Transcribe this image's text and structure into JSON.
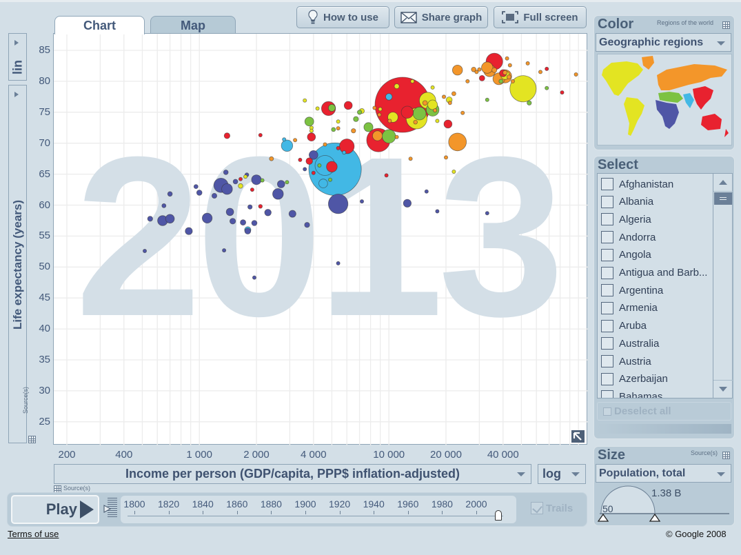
{
  "tabs": [
    {
      "label": "Chart",
      "active": true
    },
    {
      "label": "Map",
      "active": false
    }
  ],
  "toolbar": {
    "how_to_use": "How to use",
    "share_graph": "Share graph",
    "full_screen": "Full screen"
  },
  "yaxis": {
    "scale_label": "lin",
    "title": "Life expectancy (years)",
    "source_label": "Source(s)"
  },
  "xaxis": {
    "indicator": "Income per person (GDP/capita, PPP$ inflation-adjusted)",
    "scale": "log",
    "source_label": "Source(s)"
  },
  "play": {
    "label": "Play",
    "years": [
      "1800",
      "1820",
      "1840",
      "1860",
      "1880",
      "1900",
      "1920",
      "1940",
      "1960",
      "1980",
      "2000"
    ],
    "current_year": "2013",
    "trails_label": "Trails",
    "trails_checked": true
  },
  "footer": {
    "terms": "Terms of use",
    "copyright": "© Google 2008"
  },
  "color_panel": {
    "title": "Color",
    "subtitle": "Regions of the world",
    "selected": "Geographic regions",
    "region_colors": {
      "america": "#e3e422",
      "europe_central_asia": "#f3962a",
      "east_asia_pacific": "#e8222f",
      "south_asia": "#42b8e5",
      "middle_east_north_africa": "#7cc242",
      "sub_saharan_africa": "#4f56a6"
    }
  },
  "select_panel": {
    "title": "Select",
    "countries": [
      "Afghanistan",
      "Albania",
      "Algeria",
      "Andorra",
      "Angola",
      "Antigua and Barb...",
      "Argentina",
      "Armenia",
      "Aruba",
      "Australia",
      "Austria",
      "Azerbaijan",
      "Bahamas"
    ],
    "deselect_label": "Deselect all"
  },
  "size_panel": {
    "title": "Size",
    "source_label": "Source(s)",
    "selected": "Population, total",
    "max_label": "1.38 B",
    "min_label": "50"
  },
  "chart_data": {
    "type": "scatter",
    "title": "2013",
    "xlabel": "Income per person (GDP/capita, PPP$ inflation-adjusted)",
    "ylabel": "Life expectancy (years)",
    "xscale": "log",
    "xlim": [
      150,
      110000
    ],
    "ylim": [
      21,
      87
    ],
    "xticks": [
      200,
      400,
      1000,
      2000,
      4000,
      10000,
      20000,
      40000
    ],
    "xtick_labels": [
      "200",
      "400",
      "1 000",
      "2 000",
      "4 000",
      "10 000",
      "20 000",
      "40 000"
    ],
    "yticks": [
      25,
      30,
      35,
      40,
      45,
      50,
      55,
      60,
      65,
      70,
      75,
      80,
      85
    ],
    "grid": true,
    "size_indicator": "Population, total (millions)",
    "points": [
      {
        "region": "east_asia_pacific",
        "x": 11800,
        "y": 76.2,
        "size": 1380
      },
      {
        "region": "south_asia",
        "x": 5200,
        "y": 65.8,
        "size": 1250
      },
      {
        "region": "america",
        "x": 51000,
        "y": 78.8,
        "size": 316
      },
      {
        "region": "east_asia_pacific",
        "x": 8800,
        "y": 70.5,
        "size": 250
      },
      {
        "region": "south_asia",
        "x": 4600,
        "y": 66.4,
        "size": 182
      },
      {
        "region": "south_asia",
        "x": 2900,
        "y": 69.6,
        "size": 60
      },
      {
        "region": "america",
        "x": 14000,
        "y": 74.0,
        "size": 200
      },
      {
        "region": "sub_saharan_africa",
        "x": 5400,
        "y": 60.2,
        "size": 173
      },
      {
        "region": "south_asia",
        "x": 4500,
        "y": 63.5,
        "size": 35
      },
      {
        "region": "europe_central_asia",
        "x": 23000,
        "y": 70.2,
        "size": 143
      },
      {
        "region": "east_asia_pacific",
        "x": 36000,
        "y": 83.2,
        "size": 127
      },
      {
        "region": "america",
        "x": 16000,
        "y": 76.9,
        "size": 122
      },
      {
        "region": "east_asia_pacific",
        "x": 6000,
        "y": 69.5,
        "size": 98
      },
      {
        "region": "sub_saharan_africa",
        "x": 1300,
        "y": 63.2,
        "size": 94
      },
      {
        "region": "middle_east_north_africa",
        "x": 10000,
        "y": 71.1,
        "size": 82
      },
      {
        "region": "europe_central_asia",
        "x": 41000,
        "y": 80.8,
        "size": 80
      },
      {
        "region": "middle_east_north_africa",
        "x": 14500,
        "y": 74.8,
        "size": 77
      },
      {
        "region": "middle_east_north_africa",
        "x": 17000,
        "y": 75.4,
        "size": 75
      },
      {
        "region": "east_asia_pacific",
        "x": 4800,
        "y": 75.6,
        "size": 90
      },
      {
        "region": "europe_central_asia",
        "x": 34000,
        "y": 81.7,
        "size": 64
      },
      {
        "region": "europe_central_asia",
        "x": 38000,
        "y": 80.4,
        "size": 64
      },
      {
        "region": "europe_central_asia",
        "x": 33000,
        "y": 82.2,
        "size": 60
      },
      {
        "region": "east_asia_pacific",
        "x": 12500,
        "y": 75.0,
        "size": 67
      },
      {
        "region": "sub_saharan_africa",
        "x": 1400,
        "y": 62.6,
        "size": 53
      },
      {
        "region": "sub_saharan_africa",
        "x": 2000,
        "y": 64.1,
        "size": 44
      },
      {
        "region": "east_asia_pacific",
        "x": 5000,
        "y": 66.2,
        "size": 53
      },
      {
        "region": "middle_east_north_africa",
        "x": 3800,
        "y": 73.5,
        "size": 36
      },
      {
        "region": "sub_saharan_africa",
        "x": 1100,
        "y": 57.9,
        "size": 45
      },
      {
        "region": "sub_saharan_africa",
        "x": 2600,
        "y": 61.8,
        "size": 52
      },
      {
        "region": "europe_central_asia",
        "x": 23000,
        "y": 81.8,
        "size": 46
      },
      {
        "region": "middle_east_north_africa",
        "x": 7800,
        "y": 72.6,
        "size": 38
      },
      {
        "region": "america",
        "x": 10500,
        "y": 74.2,
        "size": 47
      },
      {
        "region": "europe_central_asia",
        "x": 8700,
        "y": 71.2,
        "size": 45
      },
      {
        "region": "sub_saharan_africa",
        "x": 640,
        "y": 57.5,
        "size": 46
      },
      {
        "region": "sub_saharan_africa",
        "x": 700,
        "y": 57.8,
        "size": 35
      },
      {
        "region": "america",
        "x": 17000,
        "y": 76.2,
        "size": 42
      },
      {
        "region": "east_asia_pacific",
        "x": 3900,
        "y": 71.0,
        "size": 30
      },
      {
        "region": "sub_saharan_africa",
        "x": 2700,
        "y": 63.4,
        "size": 25
      },
      {
        "region": "sub_saharan_africa",
        "x": 1450,
        "y": 58.9,
        "size": 25
      },
      {
        "region": "sub_saharan_africa",
        "x": 880,
        "y": 55.8,
        "size": 23
      },
      {
        "region": "sub_saharan_africa",
        "x": 3100,
        "y": 58.6,
        "size": 22
      },
      {
        "region": "america",
        "x": 41000,
        "y": 81.0,
        "size": 35
      },
      {
        "region": "middle_east_north_africa",
        "x": 5000,
        "y": 75.7,
        "size": 22
      },
      {
        "region": "sub_saharan_africa",
        "x": 2300,
        "y": 58.8,
        "size": 20
      },
      {
        "region": "sub_saharan_africa",
        "x": 1800,
        "y": 55.8,
        "size": 16
      },
      {
        "region": "south_asia",
        "x": 1800,
        "y": 56.0,
        "size": 18
      },
      {
        "region": "sub_saharan_africa",
        "x": 1500,
        "y": 57.4,
        "size": 15
      },
      {
        "region": "sub_saharan_africa",
        "x": 1700,
        "y": 57.2,
        "size": 14
      },
      {
        "region": "sub_saharan_africa",
        "x": 1950,
        "y": 57.1,
        "size": 13
      },
      {
        "region": "sub_saharan_africa",
        "x": 3700,
        "y": 56.8,
        "size": 12
      },
      {
        "region": "sub_saharan_africa",
        "x": 1000,
        "y": 62.0,
        "size": 13
      },
      {
        "region": "sub_saharan_africa",
        "x": 550,
        "y": 57.8,
        "size": 12
      },
      {
        "region": "sub_saharan_africa",
        "x": 1200,
        "y": 61.5,
        "size": 11
      },
      {
        "region": "sub_saharan_africa",
        "x": 1550,
        "y": 63.8,
        "size": 10
      },
      {
        "region": "sub_saharan_africa",
        "x": 1850,
        "y": 59.7,
        "size": 9
      },
      {
        "region": "sub_saharan_africa",
        "x": 1380,
        "y": 65.3,
        "size": 10
      },
      {
        "region": "sub_saharan_africa",
        "x": 960,
        "y": 63.0,
        "size": 8
      },
      {
        "region": "sub_saharan_africa",
        "x": 700,
        "y": 61.8,
        "size": 10
      },
      {
        "region": "sub_saharan_africa",
        "x": 650,
        "y": 59.9,
        "size": 8
      },
      {
        "region": "sub_saharan_africa",
        "x": 515,
        "y": 52.6,
        "size": 6
      },
      {
        "region": "sub_saharan_africa",
        "x": 1350,
        "y": 52.7,
        "size": 4
      },
      {
        "region": "sub_saharan_africa",
        "x": 1950,
        "y": 48.3,
        "size": 5
      },
      {
        "region": "sub_saharan_africa",
        "x": 5400,
        "y": 50.6,
        "size": 2
      },
      {
        "region": "sub_saharan_africa",
        "x": 7200,
        "y": 60.6,
        "size": 4
      },
      {
        "region": "sub_saharan_africa",
        "x": 12500,
        "y": 60.3,
        "size": 28
      },
      {
        "region": "sub_saharan_africa",
        "x": 18000,
        "y": 59.0,
        "size": 2
      },
      {
        "region": "sub_saharan_africa",
        "x": 33000,
        "y": 58.7,
        "size": 2
      },
      {
        "region": "sub_saharan_africa",
        "x": 15800,
        "y": 62.2,
        "size": 3
      },
      {
        "region": "sub_saharan_africa",
        "x": 3600,
        "y": 65.8,
        "size": 3
      },
      {
        "region": "sub_saharan_africa",
        "x": 4000,
        "y": 68.1,
        "size": 35
      },
      {
        "region": "sub_saharan_africa",
        "x": 1780,
        "y": 64.9,
        "size": 7
      },
      {
        "region": "america",
        "x": 1650,
        "y": 63.1,
        "size": 10
      },
      {
        "region": "east_asia_pacific",
        "x": 1400,
        "y": 71.2,
        "size": 15
      },
      {
        "region": "east_asia_pacific",
        "x": 2100,
        "y": 71.3,
        "size": 3
      },
      {
        "region": "east_asia_pacific",
        "x": 2100,
        "y": 59.8,
        "size": 7
      },
      {
        "region": "east_asia_pacific",
        "x": 3400,
        "y": 67.3,
        "size": 3
      },
      {
        "region": "east_asia_pacific",
        "x": 3800,
        "y": 67.1,
        "size": 20
      },
      {
        "region": "east_asia_pacific",
        "x": 4000,
        "y": 65.2,
        "size": 4
      },
      {
        "region": "east_asia_pacific",
        "x": 5400,
        "y": 69.2,
        "size": 2
      },
      {
        "region": "east_asia_pacific",
        "x": 1650,
        "y": 64.2,
        "size": 3
      },
      {
        "region": "east_asia_pacific",
        "x": 1900,
        "y": 62.5,
        "size": 2
      },
      {
        "region": "east_asia_pacific",
        "x": 9700,
        "y": 64.8,
        "size": 2
      },
      {
        "region": "east_asia_pacific",
        "x": 6100,
        "y": 76.1,
        "size": 30
      },
      {
        "region": "east_asia_pacific",
        "x": 20500,
        "y": 73.1,
        "size": 30
      },
      {
        "region": "east_asia_pacific",
        "x": 40000,
        "y": 81.3,
        "size": 23
      },
      {
        "region": "east_asia_pacific",
        "x": 68000,
        "y": 82.0,
        "size": 5
      },
      {
        "region": "east_asia_pacific",
        "x": 82000,
        "y": 78.2,
        "size": 2
      },
      {
        "region": "east_asia_pacific",
        "x": 31000,
        "y": 80.5,
        "size": 14
      },
      {
        "region": "south_asia",
        "x": 2800,
        "y": 70.6,
        "size": 5
      },
      {
        "region": "south_asia",
        "x": 10000,
        "y": 77.5,
        "size": 20
      },
      {
        "region": "south_asia",
        "x": 5800,
        "y": 68.5,
        "size": 2
      },
      {
        "region": "middle_east_north_africa",
        "x": 2900,
        "y": 63.7,
        "size": 4
      },
      {
        "region": "middle_east_north_africa",
        "x": 4900,
        "y": 64.1,
        "size": 3
      },
      {
        "region": "middle_east_north_africa",
        "x": 4300,
        "y": 66.4,
        "size": 3
      },
      {
        "region": "middle_east_north_africa",
        "x": 2150,
        "y": 64.0,
        "size": 2
      },
      {
        "region": "middle_east_north_africa",
        "x": 6700,
        "y": 73.9,
        "size": 12
      },
      {
        "region": "middle_east_north_africa",
        "x": 7000,
        "y": 75.0,
        "size": 9
      },
      {
        "region": "middle_east_north_africa",
        "x": 39000,
        "y": 80.0,
        "size": 8
      },
      {
        "region": "middle_east_north_africa",
        "x": 55000,
        "y": 76.5,
        "size": 9
      },
      {
        "region": "middle_east_north_africa",
        "x": 68000,
        "y": 78.9,
        "size": 2
      },
      {
        "region": "middle_east_north_africa",
        "x": 33000,
        "y": 77.0,
        "size": 2
      },
      {
        "region": "middle_east_north_africa",
        "x": 5100,
        "y": 72.2,
        "size": 8
      },
      {
        "region": "america",
        "x": 3900,
        "y": 72.5,
        "size": 4
      },
      {
        "region": "america",
        "x": 3600,
        "y": 76.9,
        "size": 4
      },
      {
        "region": "america",
        "x": 4200,
        "y": 75.6,
        "size": 2
      },
      {
        "region": "america",
        "x": 5400,
        "y": 73.5,
        "size": 6
      },
      {
        "region": "america",
        "x": 7200,
        "y": 75.2,
        "size": 11
      },
      {
        "region": "america",
        "x": 9000,
        "y": 75.5,
        "size": 5
      },
      {
        "region": "america",
        "x": 13300,
        "y": 80.0,
        "size": 4
      },
      {
        "region": "america",
        "x": 18000,
        "y": 73.6,
        "size": 3
      },
      {
        "region": "america",
        "x": 20800,
        "y": 77.0,
        "size": 16
      },
      {
        "region": "america",
        "x": 22000,
        "y": 65.4,
        "size": 2
      },
      {
        "region": "america",
        "x": 17000,
        "y": 79.0,
        "size": 4
      },
      {
        "region": "america",
        "x": 11000,
        "y": 79.2,
        "size": 11
      },
      {
        "region": "america",
        "x": 1750,
        "y": 64.6,
        "size": 2
      },
      {
        "region": "america",
        "x": 3900,
        "y": 72.0,
        "size": 3
      },
      {
        "region": "europe_central_asia",
        "x": 4600,
        "y": 69.8,
        "size": 3
      },
      {
        "region": "europe_central_asia",
        "x": 5400,
        "y": 72.4,
        "size": 5
      },
      {
        "region": "europe_central_asia",
        "x": 6500,
        "y": 72.0,
        "size": 9
      },
      {
        "region": "europe_central_asia",
        "x": 8900,
        "y": 74.6,
        "size": 4
      },
      {
        "region": "europe_central_asia",
        "x": 10100,
        "y": 73.6,
        "size": 3
      },
      {
        "region": "europe_central_asia",
        "x": 13800,
        "y": 73.4,
        "size": 7
      },
      {
        "region": "europe_central_asia",
        "x": 15500,
        "y": 76.5,
        "size": 10
      },
      {
        "region": "europe_central_asia",
        "x": 17500,
        "y": 75.3,
        "size": 4
      },
      {
        "region": "europe_central_asia",
        "x": 19500,
        "y": 77.5,
        "size": 5
      },
      {
        "region": "europe_central_asia",
        "x": 21000,
        "y": 76.5,
        "size": 6
      },
      {
        "region": "europe_central_asia",
        "x": 22000,
        "y": 78.0,
        "size": 8
      },
      {
        "region": "europe_central_asia",
        "x": 24500,
        "y": 74.9,
        "size": 4
      },
      {
        "region": "europe_central_asia",
        "x": 26000,
        "y": 80.0,
        "size": 5
      },
      {
        "region": "europe_central_asia",
        "x": 28000,
        "y": 81.9,
        "size": 10
      },
      {
        "region": "europe_central_asia",
        "x": 29000,
        "y": 81.5,
        "size": 2
      },
      {
        "region": "europe_central_asia",
        "x": 30000,
        "y": 81.9,
        "size": 4
      },
      {
        "region": "europe_central_asia",
        "x": 36000,
        "y": 81.8,
        "size": 11
      },
      {
        "region": "europe_central_asia",
        "x": 41000,
        "y": 81.4,
        "size": 9
      },
      {
        "region": "europe_central_asia",
        "x": 43000,
        "y": 80.7,
        "size": 8
      },
      {
        "region": "europe_central_asia",
        "x": 45000,
        "y": 80.0,
        "size": 5
      },
      {
        "region": "europe_central_asia",
        "x": 43500,
        "y": 82.6,
        "size": 2
      },
      {
        "region": "europe_central_asia",
        "x": 54000,
        "y": 82.9,
        "size": 5
      },
      {
        "region": "europe_central_asia",
        "x": 63000,
        "y": 81.5,
        "size": 5
      },
      {
        "region": "europe_central_asia",
        "x": 97000,
        "y": 81.1,
        "size": 1
      },
      {
        "region": "europe_central_asia",
        "x": 42000,
        "y": 83.7,
        "size": 1
      },
      {
        "region": "europe_central_asia",
        "x": 13000,
        "y": 67.5,
        "size": 3
      },
      {
        "region": "europe_central_asia",
        "x": 11000,
        "y": 71.0,
        "size": 2
      },
      {
        "region": "europe_central_asia",
        "x": 8400,
        "y": 75.7,
        "size": 3
      },
      {
        "region": "europe_central_asia",
        "x": 20000,
        "y": 67.7,
        "size": 5
      },
      {
        "region": "europe_central_asia",
        "x": 2400,
        "y": 67.5,
        "size": 8
      },
      {
        "region": "europe_central_asia",
        "x": 3200,
        "y": 70.5,
        "size": 6
      }
    ]
  }
}
